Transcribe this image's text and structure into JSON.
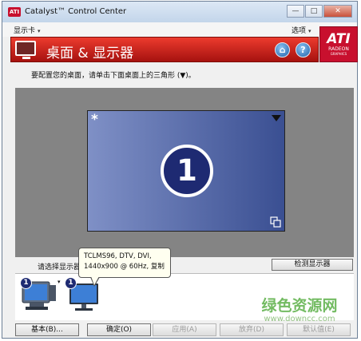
{
  "window": {
    "title": "Catalyst™ Control Center",
    "app_icon_text": "ATI",
    "minimize_glyph": "—",
    "maximize_glyph": "□",
    "close_glyph": "✕"
  },
  "menu": {
    "left_label": "显示卡",
    "right_label": "选项",
    "caret": "▾"
  },
  "header": {
    "title": "桌面 & 显示器",
    "home_glyph": "⌂",
    "help_glyph": "?"
  },
  "logo": {
    "brand": "ATI",
    "line1": "RADEON",
    "line2": "GRAPHICS"
  },
  "instruction": "要配置您的桌面，请单击下面桌面上的三角形 (▼)。",
  "desktop": {
    "primary_marker": "*",
    "display_number": "1"
  },
  "monitors_panel": {
    "label": "请选择显示器",
    "detect_button": "检测显示器",
    "thumbnails": [
      {
        "number": "1",
        "caret": "▾"
      },
      {
        "number": "1"
      }
    ]
  },
  "tooltip": {
    "line1": "TCLMS96, DTV, DVI,",
    "line2": "1440x900 @ 60Hz, 复制"
  },
  "buttons": {
    "basic": "基本(B)...",
    "ok": "确定(O)",
    "apply": "应用(A)",
    "discard": "放弃(D)",
    "defaults": "默认值(E)"
  },
  "watermark": {
    "text": "绿色资源网",
    "url": "www.downcc.com"
  },
  "colors": {
    "banner": "#c8102e",
    "monitor_fill": "#5a6eae",
    "desktop_bg": "#848484"
  }
}
